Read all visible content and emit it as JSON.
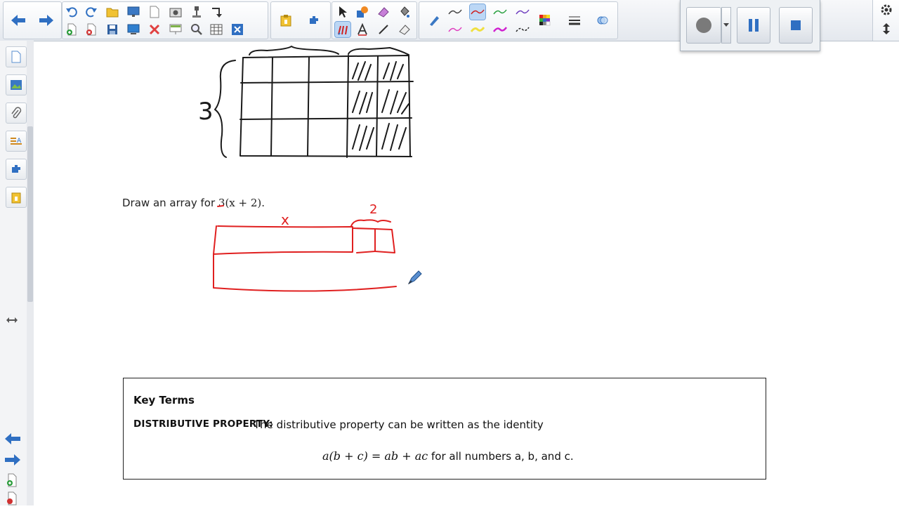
{
  "prompt": {
    "text_prefix": "Draw an array for ",
    "expression": "3(x + 2)."
  },
  "handwriting": {
    "top_array_label": "3",
    "bottom_width_label": "x",
    "bottom_part_label": "2"
  },
  "key_terms": {
    "title": "Key Terms",
    "term": "DISTRIBUTIVE PROPERTY:",
    "definition": "The distributive property can be written as the identity",
    "formula": "a(b + c) = ab + ac",
    "formula_suffix": " for all numbers a, b, and c."
  },
  "colors": {
    "ink_black": "#1a1a1a",
    "ink_red": "#e02020",
    "accent_blue": "#2f6fc2"
  },
  "toolbar": {
    "icons": [
      "back-arrow-icon",
      "forward-arrow-icon",
      "undo-icon",
      "redo-icon",
      "open-folder-icon",
      "screen-shade-icon",
      "page-icon",
      "capture-icon",
      "document-camera-icon",
      "rotate-icon",
      "add-page-icon",
      "delete-page-icon",
      "save-icon",
      "display-icon",
      "delete-icon",
      "screen-icon",
      "magnifier-icon",
      "table-icon",
      "close-box-icon",
      "gallery-icon",
      "addons-icon",
      "select-icon",
      "shapes-icon",
      "eraser-icon",
      "fill-icon",
      "pen-icon",
      "creative-pen-icon",
      "text-icon",
      "line-icon",
      "magic-eraser-icon",
      "color-palette-icon",
      "line-style-icon",
      "properties-icon"
    ]
  },
  "recorder": {
    "buttons": [
      "record-button",
      "pause-button",
      "stop-button"
    ]
  }
}
